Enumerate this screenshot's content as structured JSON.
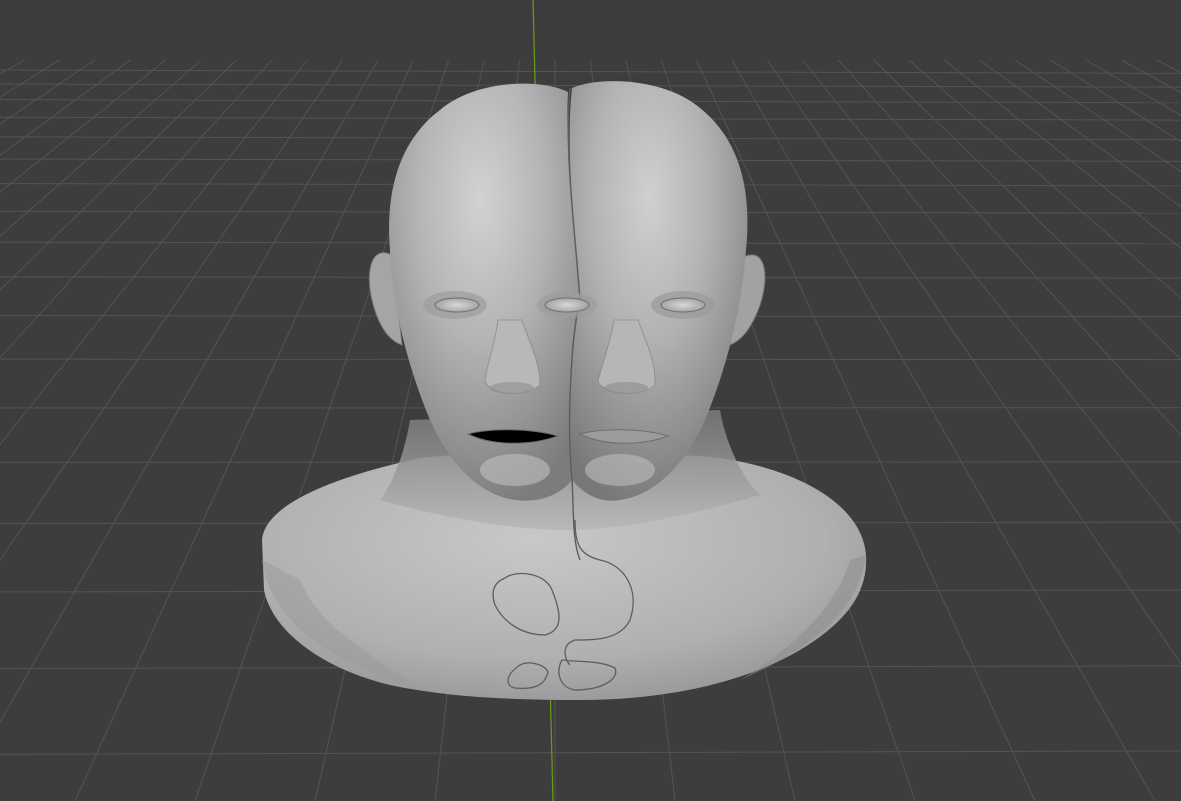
{
  "viewport": {
    "mode": "3D Viewport",
    "shading": "solid",
    "colors": {
      "background": "#3d3d3d",
      "grid_line": "#545454",
      "y_axis": "#6f9a1e",
      "mesh_fill": "#a9a9a9",
      "mesh_highlight": "#d4d4d6",
      "mesh_shadow": "#6f6f6f",
      "seam_line": "#555555"
    }
  },
  "scene": {
    "object": "mesh-bust",
    "description_visible": false
  }
}
